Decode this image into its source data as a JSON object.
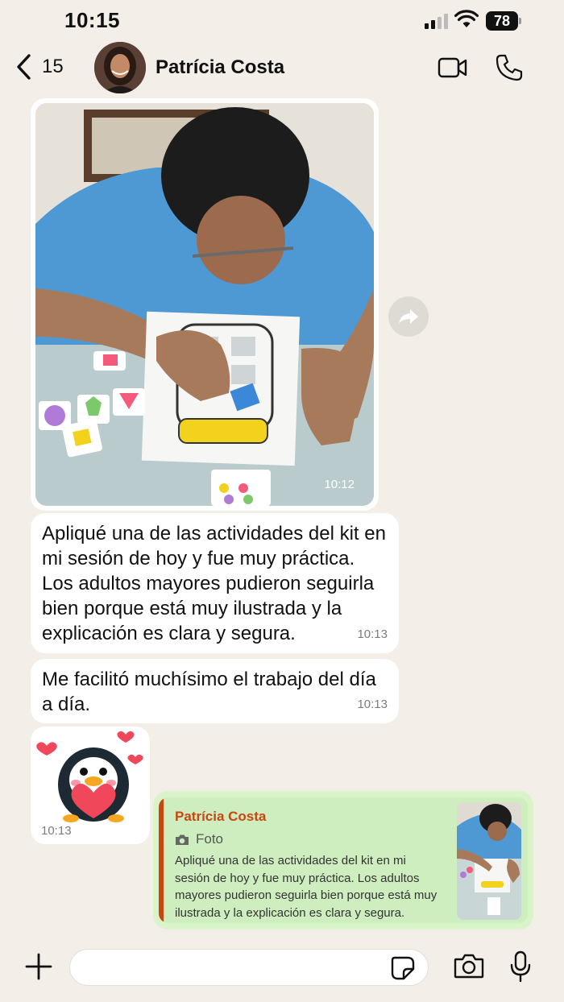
{
  "status": {
    "time": "10:15",
    "battery": "78"
  },
  "header": {
    "back_count": "15",
    "contact_name": "Patrícia Costa"
  },
  "messages": {
    "photo": {
      "time": "10:12"
    },
    "msg2": {
      "text": "Apliqué una de las actividades del kit en mi sesión de hoy y fue muy práctica. Los adultos mayores pudieron seguirla bien porque está muy ilustrada y la explicación es clara y segura.",
      "time": "10:13"
    },
    "msg3": {
      "text": "Me facilitó muchísimo el trabajo del día a día.",
      "time": "10:13"
    },
    "sticker": {
      "time": "10:13"
    }
  },
  "reply": {
    "quoted_name": "Patrícia Costa",
    "quoted_type": "Foto",
    "quoted_text": "Apliqué una de las actividades del kit en mi sesión de hoy y fue muy práctica. Los adultos mayores pudieron seguirla bien porque está muy ilustrada y la explicación es clara y segura."
  },
  "input": {
    "placeholder": ""
  },
  "colors": {
    "background": "#f3efe8",
    "outgoing_bubble": "#d9f4c9",
    "quote_accent": "#c9460e",
    "incoming_bubble": "#ffffff"
  }
}
